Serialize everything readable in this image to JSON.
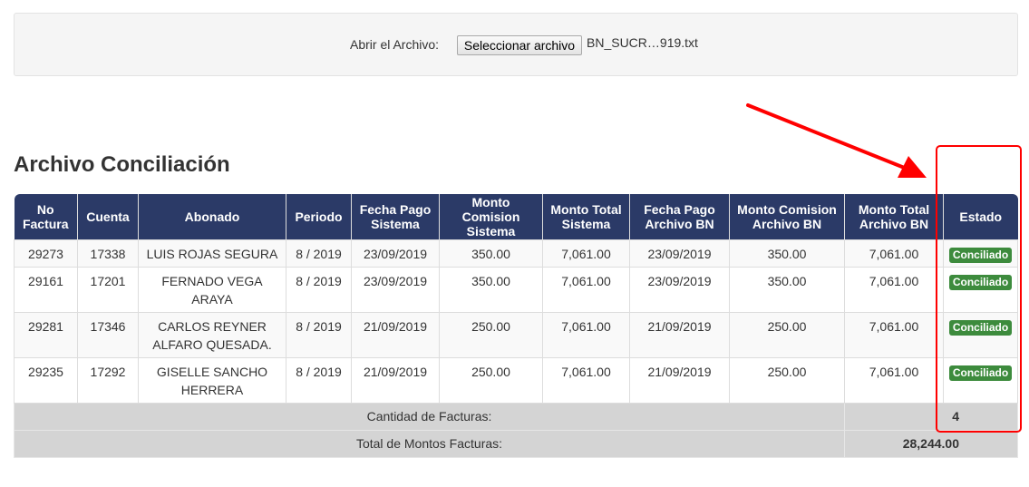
{
  "upload": {
    "label": "Abrir el Archivo:",
    "button_label": "Seleccionar archivo",
    "file_name": "BN_SUCR…919.txt"
  },
  "section": {
    "title": "Archivo Conciliación"
  },
  "table": {
    "headers": {
      "no_factura": "No Factura",
      "cuenta": "Cuenta",
      "abonado": "Abonado",
      "periodo": "Periodo",
      "fecha_pago_sistema": "Fecha Pago Sistema",
      "monto_comision_sistema": "Monto Comision Sistema",
      "monto_total_sistema": "Monto Total Sistema",
      "fecha_pago_archivo": "Fecha Pago Archivo BN",
      "monto_comision_archivo": "Monto Comision Archivo BN",
      "monto_total_archivo": "Monto Total Archivo BN",
      "estado": "Estado"
    },
    "rows": [
      [
        "29273",
        "17338",
        "LUIS ROJAS SEGURA",
        "8 / 2019",
        "23/09/2019",
        "350.00",
        "7,061.00",
        "23/09/2019",
        "350.00",
        "7,061.00",
        "Conciliado"
      ],
      [
        "29161",
        "17201",
        "FERNADO VEGA ARAYA",
        "8 / 2019",
        "23/09/2019",
        "350.00",
        "7,061.00",
        "23/09/2019",
        "350.00",
        "7,061.00",
        "Conciliado"
      ],
      [
        "29281",
        "17346",
        "CARLOS REYNER ALFARO QUESADA.",
        "8 / 2019",
        "21/09/2019",
        "250.00",
        "7,061.00",
        "21/09/2019",
        "250.00",
        "7,061.00",
        "Conciliado"
      ],
      [
        "29235",
        "17292",
        "GISELLE SANCHO HERRERA",
        "8 / 2019",
        "21/09/2019",
        "250.00",
        "7,061.00",
        "21/09/2019",
        "250.00",
        "7,061.00",
        "Conciliado"
      ]
    ],
    "footer": {
      "count_label": "Cantidad de Facturas:",
      "count_value": "4",
      "total_label": "Total de Montos Facturas:",
      "total_value": "28,244.00"
    }
  },
  "colors": {
    "header_bg": "#2b3a67",
    "badge_green": "#3d8b3d",
    "annotation_red": "#ff0000"
  }
}
